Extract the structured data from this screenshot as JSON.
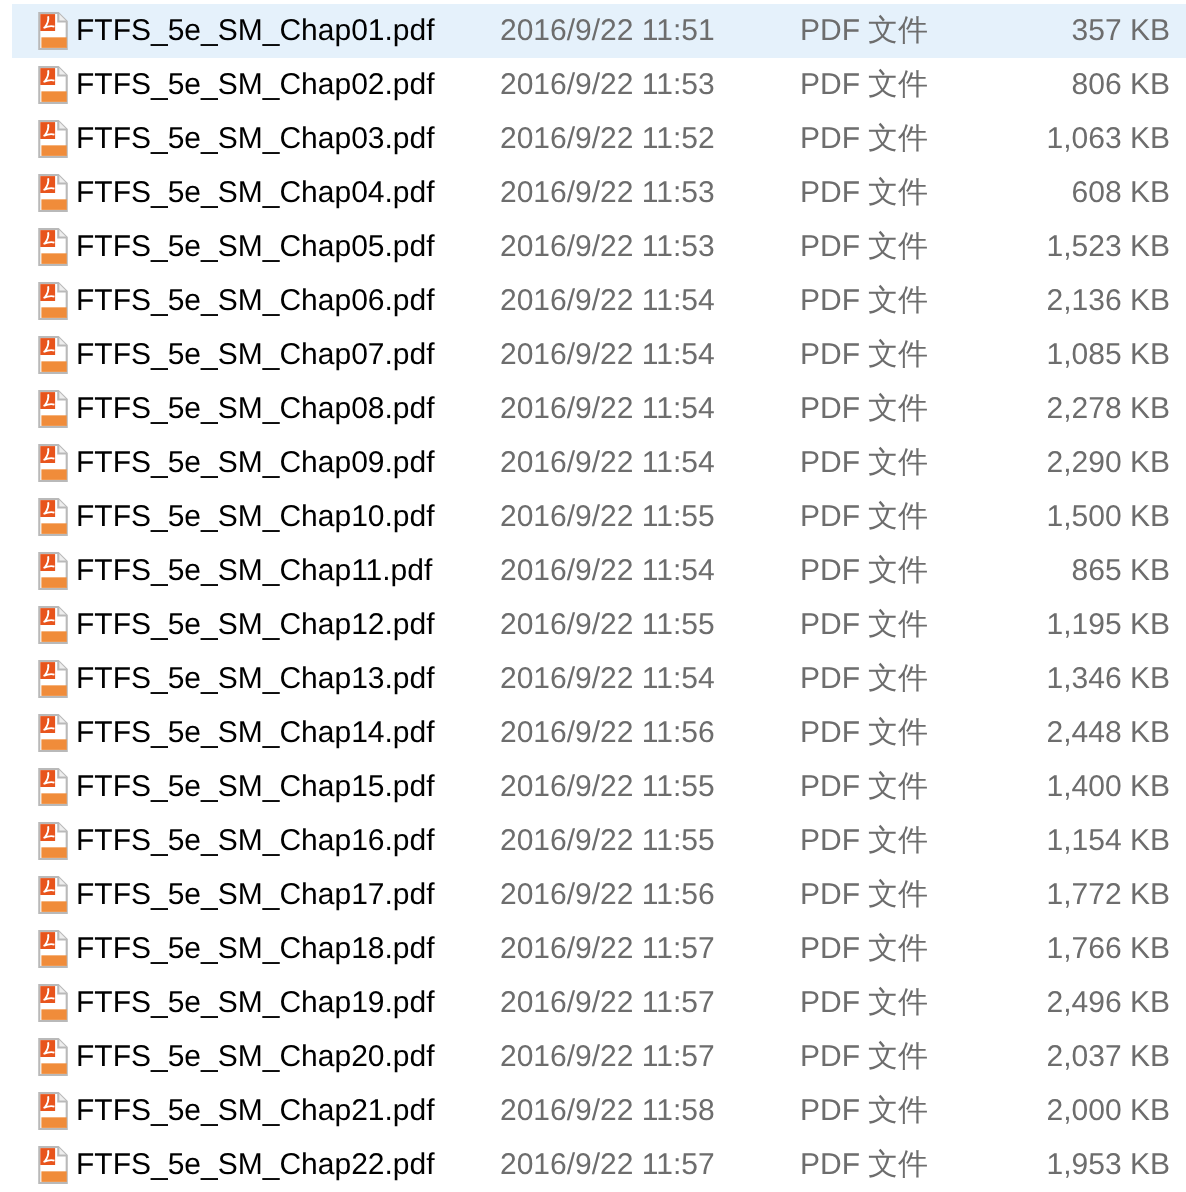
{
  "files": [
    {
      "name": "FTFS_5e_SM_Chap01.pdf",
      "modified": "2016/9/22 11:51",
      "type": "PDF 文件",
      "size": "357 KB",
      "selected": true
    },
    {
      "name": "FTFS_5e_SM_Chap02.pdf",
      "modified": "2016/9/22 11:53",
      "type": "PDF 文件",
      "size": "806 KB",
      "selected": false
    },
    {
      "name": "FTFS_5e_SM_Chap03.pdf",
      "modified": "2016/9/22 11:52",
      "type": "PDF 文件",
      "size": "1,063 KB",
      "selected": false
    },
    {
      "name": "FTFS_5e_SM_Chap04.pdf",
      "modified": "2016/9/22 11:53",
      "type": "PDF 文件",
      "size": "608 KB",
      "selected": false
    },
    {
      "name": "FTFS_5e_SM_Chap05.pdf",
      "modified": "2016/9/22 11:53",
      "type": "PDF 文件",
      "size": "1,523 KB",
      "selected": false
    },
    {
      "name": "FTFS_5e_SM_Chap06.pdf",
      "modified": "2016/9/22 11:54",
      "type": "PDF 文件",
      "size": "2,136 KB",
      "selected": false
    },
    {
      "name": "FTFS_5e_SM_Chap07.pdf",
      "modified": "2016/9/22 11:54",
      "type": "PDF 文件",
      "size": "1,085 KB",
      "selected": false
    },
    {
      "name": "FTFS_5e_SM_Chap08.pdf",
      "modified": "2016/9/22 11:54",
      "type": "PDF 文件",
      "size": "2,278 KB",
      "selected": false
    },
    {
      "name": "FTFS_5e_SM_Chap09.pdf",
      "modified": "2016/9/22 11:54",
      "type": "PDF 文件",
      "size": "2,290 KB",
      "selected": false
    },
    {
      "name": "FTFS_5e_SM_Chap10.pdf",
      "modified": "2016/9/22 11:55",
      "type": "PDF 文件",
      "size": "1,500 KB",
      "selected": false
    },
    {
      "name": "FTFS_5e_SM_Chap11.pdf",
      "modified": "2016/9/22 11:54",
      "type": "PDF 文件",
      "size": "865 KB",
      "selected": false
    },
    {
      "name": "FTFS_5e_SM_Chap12.pdf",
      "modified": "2016/9/22 11:55",
      "type": "PDF 文件",
      "size": "1,195 KB",
      "selected": false
    },
    {
      "name": "FTFS_5e_SM_Chap13.pdf",
      "modified": "2016/9/22 11:54",
      "type": "PDF 文件",
      "size": "1,346 KB",
      "selected": false
    },
    {
      "name": "FTFS_5e_SM_Chap14.pdf",
      "modified": "2016/9/22 11:56",
      "type": "PDF 文件",
      "size": "2,448 KB",
      "selected": false
    },
    {
      "name": "FTFS_5e_SM_Chap15.pdf",
      "modified": "2016/9/22 11:55",
      "type": "PDF 文件",
      "size": "1,400 KB",
      "selected": false
    },
    {
      "name": "FTFS_5e_SM_Chap16.pdf",
      "modified": "2016/9/22 11:55",
      "type": "PDF 文件",
      "size": "1,154 KB",
      "selected": false
    },
    {
      "name": "FTFS_5e_SM_Chap17.pdf",
      "modified": "2016/9/22 11:56",
      "type": "PDF 文件",
      "size": "1,772 KB",
      "selected": false
    },
    {
      "name": "FTFS_5e_SM_Chap18.pdf",
      "modified": "2016/9/22 11:57",
      "type": "PDF 文件",
      "size": "1,766 KB",
      "selected": false
    },
    {
      "name": "FTFS_5e_SM_Chap19.pdf",
      "modified": "2016/9/22 11:57",
      "type": "PDF 文件",
      "size": "2,496 KB",
      "selected": false
    },
    {
      "name": "FTFS_5e_SM_Chap20.pdf",
      "modified": "2016/9/22 11:57",
      "type": "PDF 文件",
      "size": "2,037 KB",
      "selected": false
    },
    {
      "name": "FTFS_5e_SM_Chap21.pdf",
      "modified": "2016/9/22 11:58",
      "type": "PDF 文件",
      "size": "2,000 KB",
      "selected": false
    },
    {
      "name": "FTFS_5e_SM_Chap22.pdf",
      "modified": "2016/9/22 11:57",
      "type": "PDF 文件",
      "size": "1,953 KB",
      "selected": false
    }
  ]
}
